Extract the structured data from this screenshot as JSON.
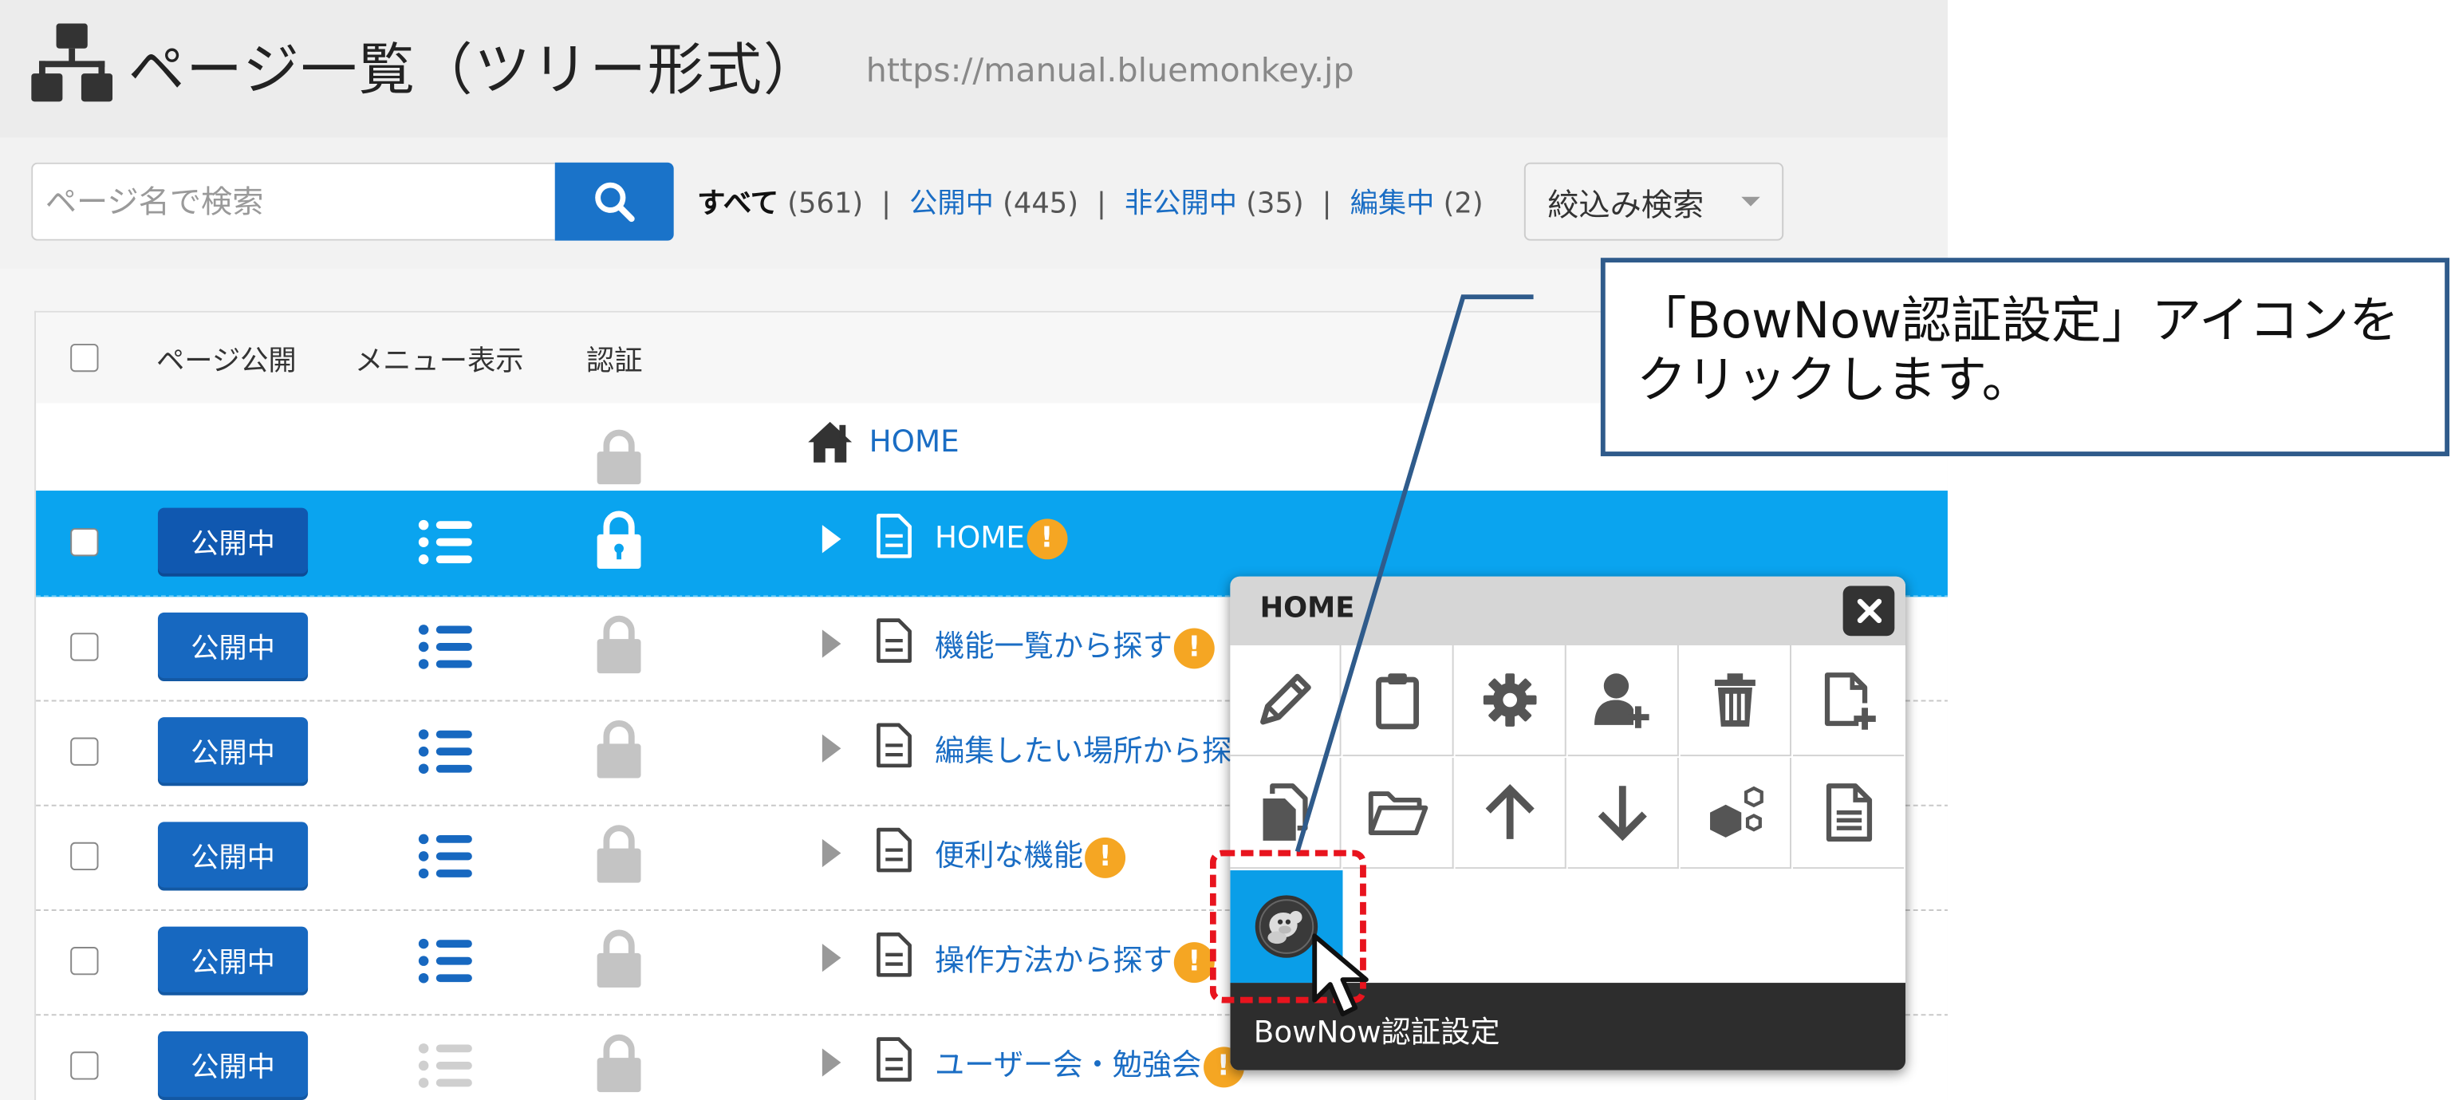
{
  "header": {
    "title": "ページ一覧（ツリー形式）",
    "site_url": "https://manual.bluemonkey.jp"
  },
  "toolbar": {
    "search_placeholder": "ページ名で検索",
    "filters": {
      "all_label": "すべて",
      "all_count": "(561)",
      "public_label": "公開中",
      "public_count": "(445)",
      "private_label": "非公開中",
      "private_count": "(35)",
      "editing_label": "編集中",
      "editing_count": "(2)",
      "separator": "|"
    },
    "filter_dropdown": "絞込み検索"
  },
  "table": {
    "headers": {
      "publish": "ページ公開",
      "menu": "メニュー表示",
      "auth": "認証"
    },
    "root_label": "HOME",
    "rows": [
      {
        "status": "公開中",
        "name": "HOME",
        "warning": true,
        "menu_visible": true,
        "selected": true
      },
      {
        "status": "公開中",
        "name": "機能一覧から探す",
        "warning": true,
        "menu_visible": true,
        "selected": false
      },
      {
        "status": "公開中",
        "name": "編集したい場所から探",
        "warning": false,
        "menu_visible": true,
        "selected": false
      },
      {
        "status": "公開中",
        "name": "便利な機能",
        "warning": true,
        "menu_visible": true,
        "selected": false
      },
      {
        "status": "公開中",
        "name": "操作方法から探す",
        "warning": true,
        "menu_visible": true,
        "selected": false
      },
      {
        "status": "公開中",
        "name": "ユーザー会・勉強会",
        "warning": true,
        "menu_visible": false,
        "selected": false
      }
    ],
    "warning_glyph": "!"
  },
  "popup": {
    "title": "HOME",
    "icons_row1": [
      "pencil-icon",
      "clipboard-icon",
      "gear-icon",
      "add-user-icon",
      "trash-icon",
      "new-page-icon"
    ],
    "icons_row2": [
      "copy-icon",
      "folder-icon",
      "arrow-up-icon",
      "arrow-down-icon",
      "cubes-icon",
      "document-icon"
    ],
    "special_icon": "bownow-monkey-icon",
    "tooltip": "BowNow認証設定"
  },
  "callout": {
    "text": "「BowNow認証設定」アイコンをクリックします。"
  },
  "colors": {
    "selected_row": "#0aa4ef",
    "publish_button": "#1768c0",
    "link": "#1a6dc4",
    "warning": "#f5a623",
    "highlight": "#e8141e",
    "callout_border": "#2f5b8b"
  }
}
